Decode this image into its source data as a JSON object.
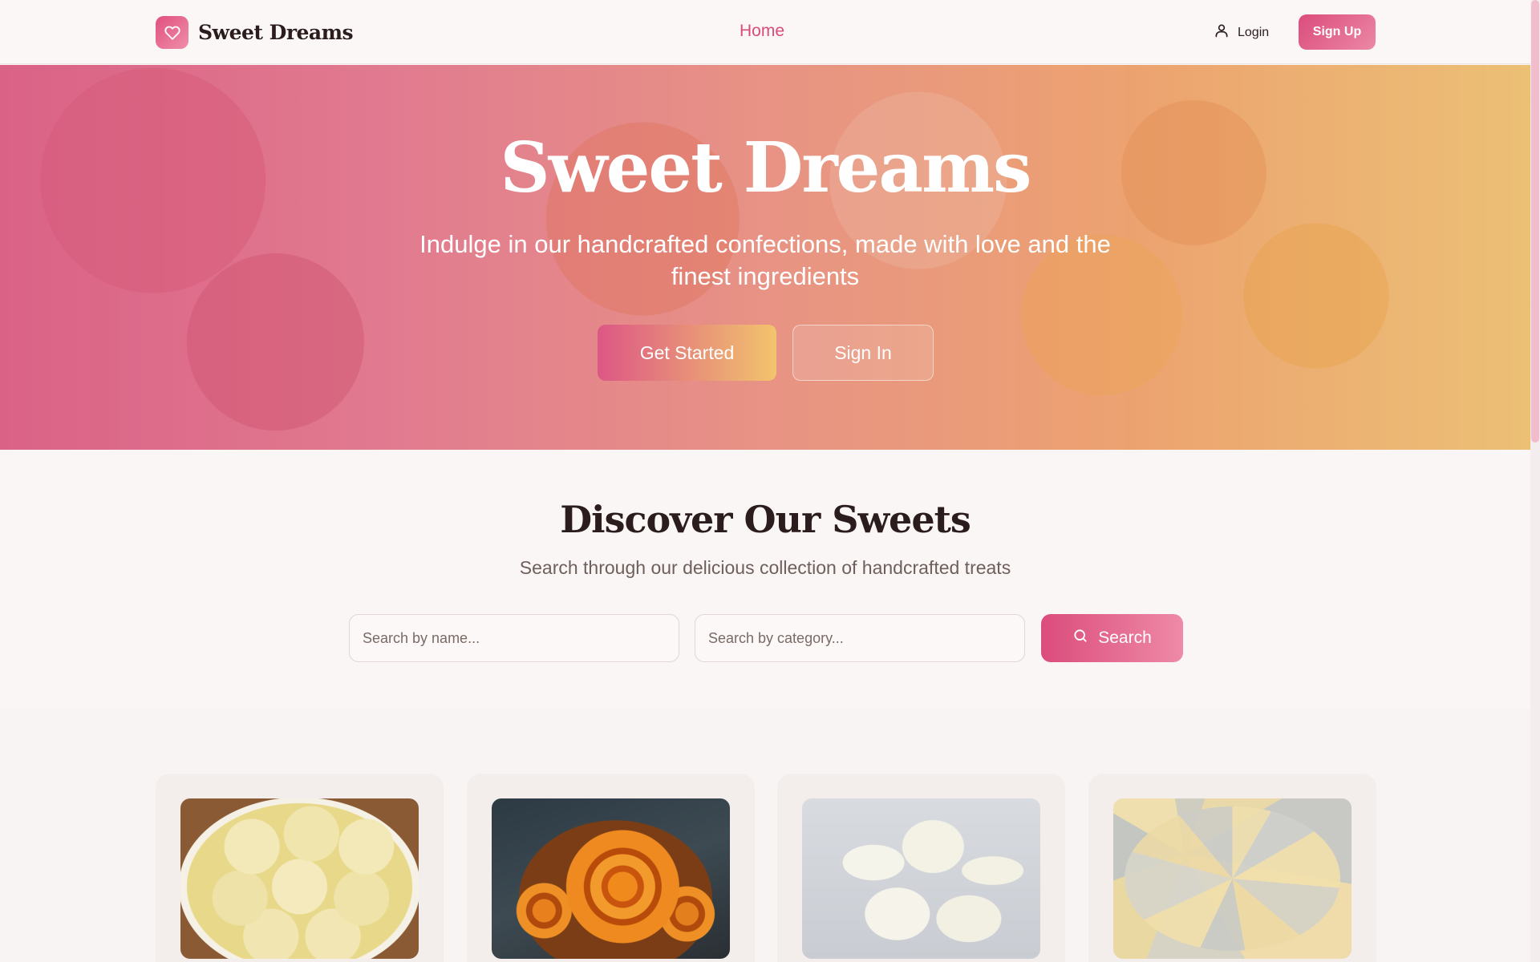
{
  "nav": {
    "brand": "Sweet Dreams",
    "home": "Home",
    "login": "Login",
    "signup": "Sign Up"
  },
  "hero": {
    "title": "Sweet Dreams",
    "subtitle": "Indulge in our handcrafted confections, made with love and the finest ingredients",
    "get_started": "Get Started",
    "sign_in": "Sign In"
  },
  "discover": {
    "title": "Discover Our Sweets",
    "subtitle": "Search through our delicious collection of handcrafted treats",
    "name_placeholder": "Search by name...",
    "category_placeholder": "Search by category...",
    "search_label": "Search"
  },
  "colors": {
    "accent": "#d94b79",
    "accent_light": "#ee8aa7",
    "background": "#faf6f5",
    "text": "#2b1d1d"
  },
  "icons": {
    "brand": "heart-icon",
    "login": "user-icon",
    "search": "search-icon"
  }
}
